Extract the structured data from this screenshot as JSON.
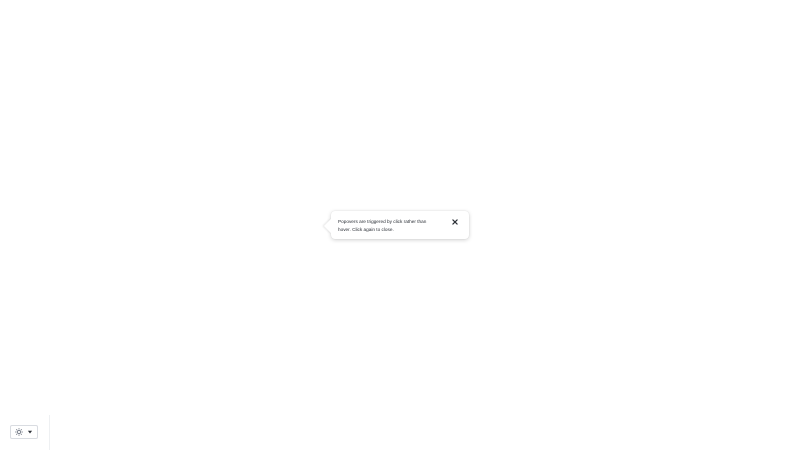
{
  "popover": {
    "text": "Popovers are triggered by click rather than hover. Click again to close.",
    "close_icon": "close-icon"
  },
  "theme_toggle": {
    "icon": "sun-icon",
    "dropdown_icon": "caret-down-icon"
  }
}
